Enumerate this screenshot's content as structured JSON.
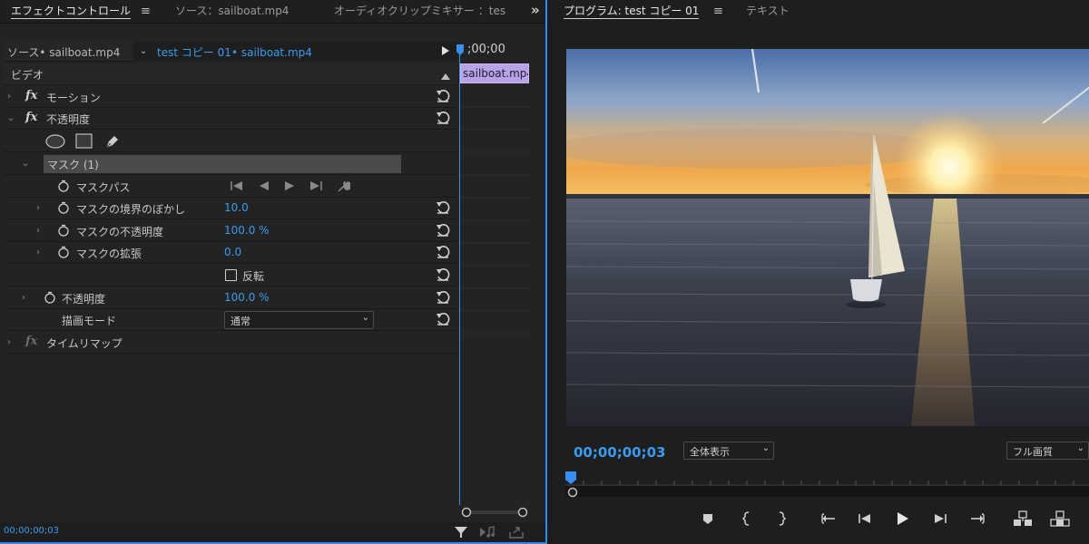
{
  "left_panel": {
    "tabs": [
      {
        "label": "エフェクトコントロール",
        "active": true
      },
      {
        "label": "ソース：sailboat.mp4",
        "active": false
      },
      {
        "label": "オーディオクリップミキサー ：tes",
        "active": false
      }
    ],
    "menu_glyph": "≡",
    "overflow_glyph": "»",
    "source_clip": "ソース• sailboat.mp4",
    "sequence_clip": "test コピー 01• sailboat.mp4",
    "timeline_timecode": ";00;00",
    "clip_name": "sailboat.mp4",
    "section_video": "ビデオ",
    "rows": {
      "motion": "モーション",
      "opacity_effect": "不透明度",
      "mask": "マスク (1)",
      "mask_path": "マスクパス",
      "mask_feather": "マスクの境界のぼかし",
      "mask_feather_value": "10.0",
      "mask_opacity": "マスクの不透明度",
      "mask_opacity_value": "100.0 %",
      "mask_expansion": "マスクの拡張",
      "mask_expansion_value": "0.0",
      "inverted": "反転",
      "opacity": "不透明度",
      "opacity_value": "100.0 %",
      "blend_mode": "描画モード",
      "blend_mode_value": "通常",
      "time_remap": "タイムリマップ"
    },
    "bottom_timecode": "00;00;00;03"
  },
  "right_panel": {
    "tabs": [
      {
        "label": "プログラム: test コピー 01",
        "active": true
      },
      {
        "label": "テキスト",
        "active": false
      }
    ],
    "menu_glyph": "≡",
    "timecode": "00;00;00;03",
    "zoom": "全体表示",
    "quality": "フル画質"
  },
  "colors": {
    "accent": "#3a9cf0",
    "clip": "#b8a3e8",
    "panel": "#232323"
  }
}
